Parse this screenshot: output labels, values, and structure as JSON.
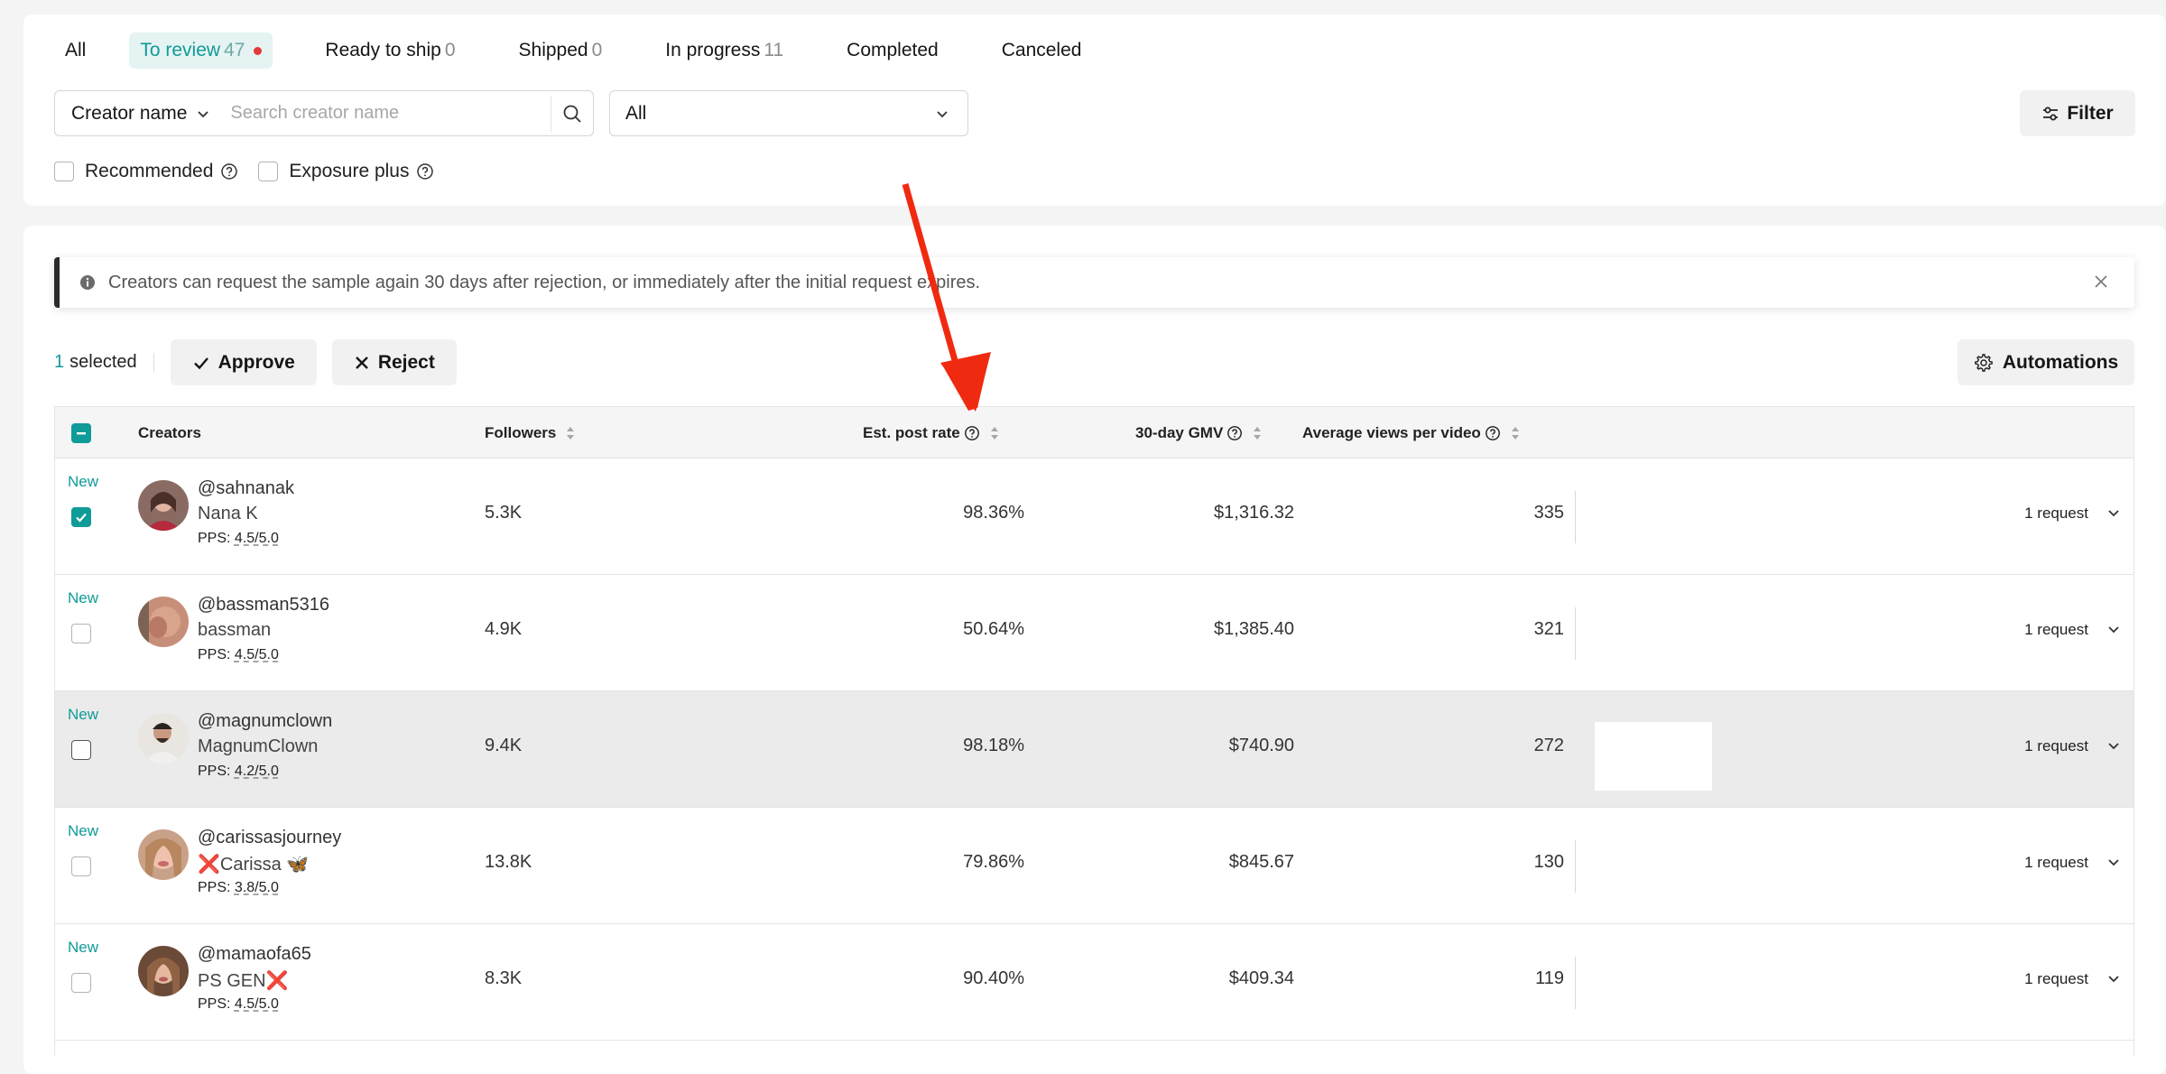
{
  "tabs": [
    {
      "label": "All",
      "count": ""
    },
    {
      "label": "To review",
      "count": "47"
    },
    {
      "label": "Ready to ship",
      "count": "0"
    },
    {
      "label": "Shipped",
      "count": "0"
    },
    {
      "label": "In progress",
      "count": "11"
    },
    {
      "label": "Completed",
      "count": ""
    },
    {
      "label": "Canceled",
      "count": ""
    }
  ],
  "search": {
    "type_label": "Creator name",
    "placeholder": "Search creator name",
    "value": ""
  },
  "status_select": {
    "value": "All"
  },
  "filter_label": "Filter",
  "checks": {
    "recommended": "Recommended",
    "exposure_plus": "Exposure plus"
  },
  "notice": {
    "text": "Creators can request the sample again 30 days after rejection, or immediately after the initial request expires."
  },
  "bulk": {
    "selected_count": "1",
    "selected_label": "selected",
    "approve_label": "Approve",
    "reject_label": "Reject",
    "automations_label": "Automations"
  },
  "table": {
    "headers": {
      "creators": "Creators",
      "followers": "Followers",
      "post_rate": "Est. post rate",
      "gmv": "30-day GMV",
      "views": "Average views per video"
    },
    "rows": [
      {
        "tag": "New",
        "handle": "@sahnanak",
        "name": "Nana K",
        "pps_label": "PPS:",
        "pps": "4.5/5.0",
        "followers": "5.3K",
        "post_rate": "98.36%",
        "gmv": "$1,316.32",
        "views": "335",
        "requests": "1 request",
        "checked": true
      },
      {
        "tag": "New",
        "handle": "@bassman5316",
        "name": "bassman",
        "pps_label": "PPS:",
        "pps": "4.5/5.0",
        "followers": "4.9K",
        "post_rate": "50.64%",
        "gmv": "$1,385.40",
        "views": "321",
        "requests": "1 request",
        "checked": false
      },
      {
        "tag": "New",
        "handle": "@magnumclown",
        "name": "MagnumClown",
        "pps_label": "PPS:",
        "pps": "4.2/5.0",
        "followers": "9.4K",
        "post_rate": "98.18%",
        "gmv": "$740.90",
        "views": "272",
        "requests": "1 request",
        "checked": false
      },
      {
        "tag": "New",
        "handle": "@carissasjourney",
        "name": "❌Carissa 🦋",
        "pps_label": "PPS:",
        "pps": "3.8/5.0",
        "followers": "13.8K",
        "post_rate": "79.86%",
        "gmv": "$845.67",
        "views": "130",
        "requests": "1 request",
        "checked": false
      },
      {
        "tag": "New",
        "handle": "@mamaofa65",
        "name": "PS GEN❌",
        "pps_label": "PPS:",
        "pps": "4.5/5.0",
        "followers": "8.3K",
        "post_rate": "90.40%",
        "gmv": "$409.34",
        "views": "119",
        "requests": "1 request",
        "checked": false
      }
    ]
  },
  "colors": {
    "accent": "#0f9b98",
    "arrow": "#f02a10",
    "badge_dot": "#e23b3b"
  }
}
